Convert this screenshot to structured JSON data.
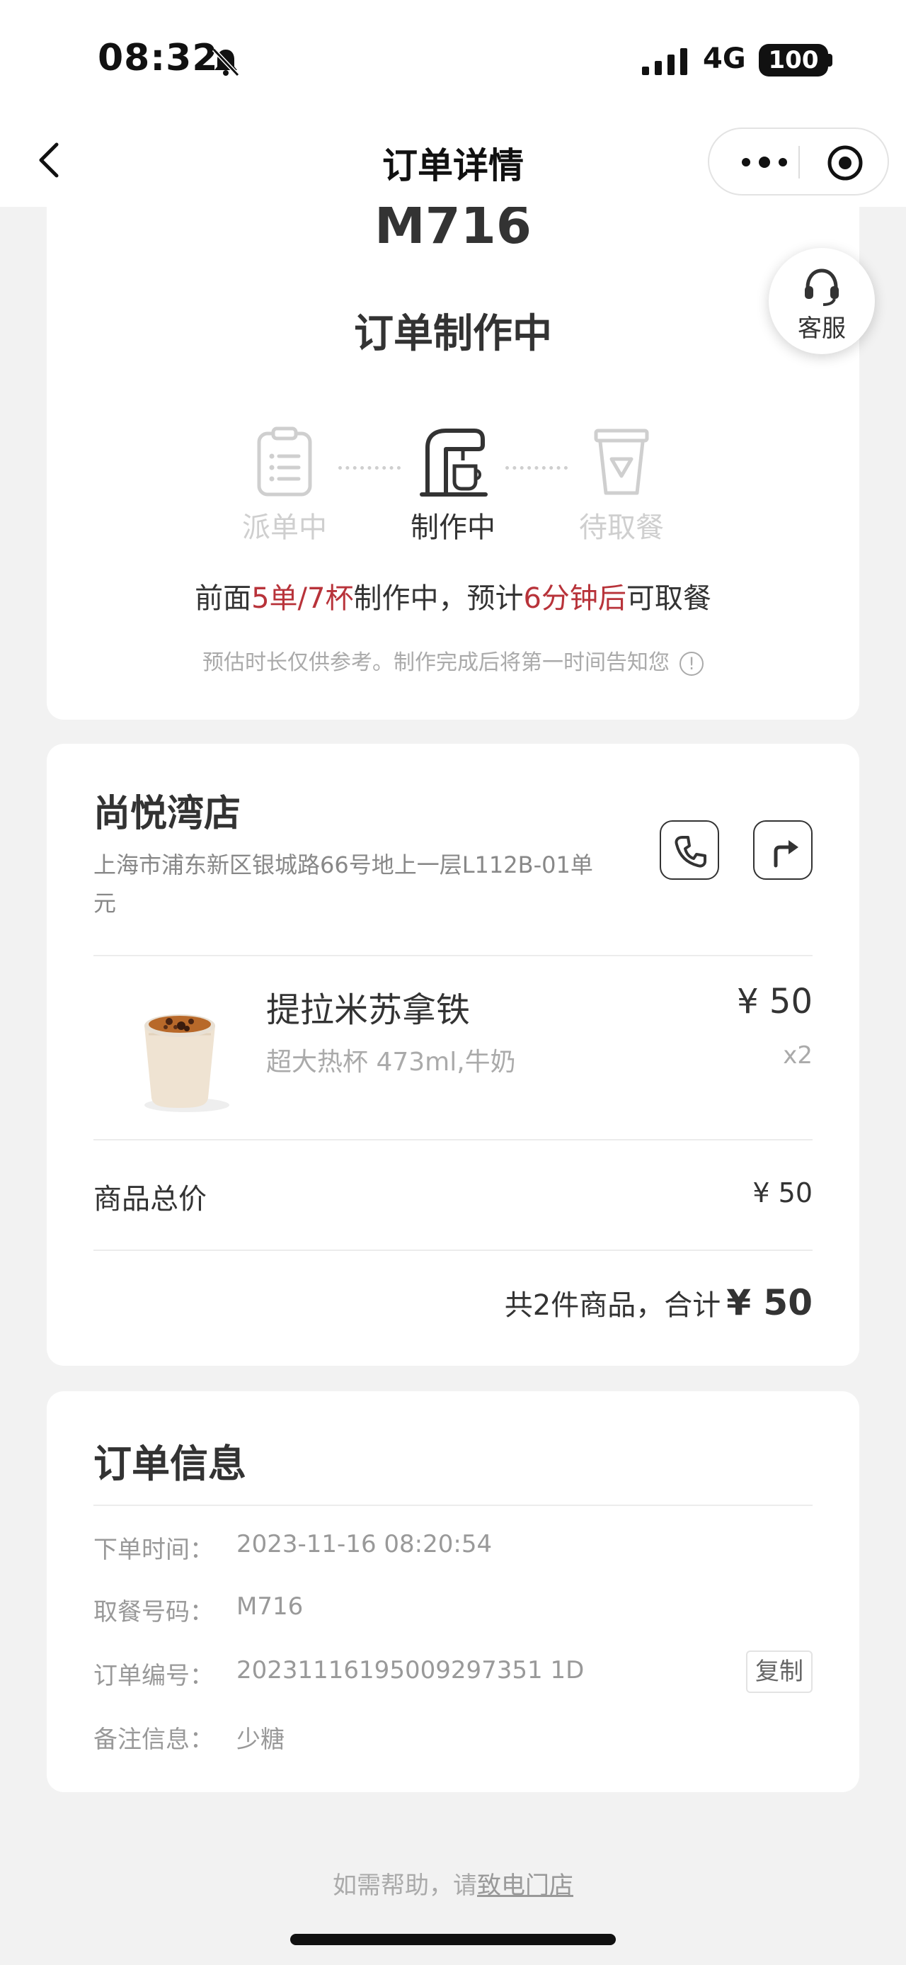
{
  "status_bar": {
    "time": "08:32",
    "network": "4G",
    "battery": "100"
  },
  "nav": {
    "title": "订单详情"
  },
  "order": {
    "code": "M716",
    "status": "订单制作中",
    "steps": [
      {
        "label": "派单中",
        "state": "done"
      },
      {
        "label": "制作中",
        "state": "active"
      },
      {
        "label": "待取餐",
        "state": "pending"
      }
    ],
    "queue": {
      "prefix": "前面",
      "count": "5单/7杯",
      "middle": "制作中，预计",
      "eta": "6分钟后",
      "suffix": "可取餐"
    },
    "hint": "预估时长仅供参考。制作完成后将第一时间告知您",
    "service_label": "客服"
  },
  "store": {
    "name": "尚悦湾店",
    "address_line1": "上海市浦东新区银城路66号地上一层L112B-01单",
    "address_line2": "元"
  },
  "product": {
    "name": "提拉米苏拿铁",
    "spec": "超大热杯 473ml,牛奶",
    "price": "¥ 50",
    "qty": "x2"
  },
  "summary": {
    "subtotal_label": "商品总价",
    "subtotal_value": "¥ 50",
    "total_prefix": "共2件商品，合计",
    "total_amount": "¥ 50"
  },
  "order_info": {
    "title": "订单信息",
    "rows": [
      {
        "key": "下单时间：",
        "value": "2023-11-16 08:20:54"
      },
      {
        "key": "取餐号码：",
        "value": "M716"
      },
      {
        "key": "订单编号：",
        "value": "20231116195009297351 1D"
      },
      {
        "key": "备注信息：",
        "value": "少糖"
      }
    ],
    "copy_label": "复制"
  },
  "footer": {
    "prefix": "如需帮助，请",
    "link": "致电门店"
  },
  "colors": {
    "accent": "#b8333a",
    "text": "#333333",
    "muted": "#aaaaaa",
    "background": "#f2f2f2"
  }
}
